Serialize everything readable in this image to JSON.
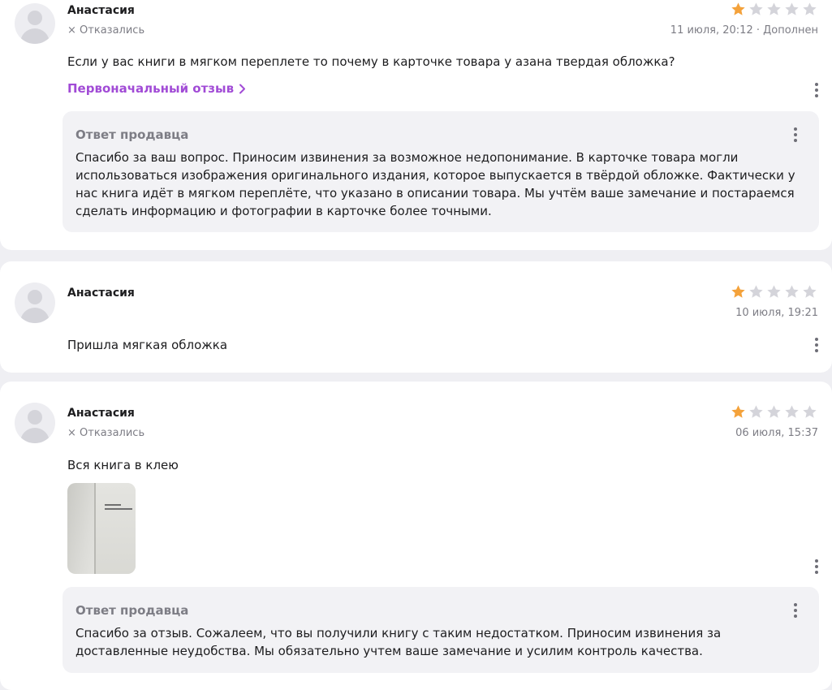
{
  "colors": {
    "star_filled": "#f4a23b",
    "star_empty": "#d4d4da",
    "link": "#a14bd6",
    "muted": "#7d7d85"
  },
  "reviews": [
    {
      "author": "Анастасия",
      "status": "Отказались",
      "rating": 1,
      "date": "11 июля, 20:12 · Дополнен",
      "text": "Если у вас книги в мягком переплете то почему в карточке товара у азана твердая обложка?",
      "original_link": "Первоначальный отзыв",
      "seller_reply": {
        "title": "Ответ продавца",
        "text": "Спасибо за ваш вопрос. Приносим извинения за возможное недопонимание. В карточке товара могли использоваться изображения оригинального издания, которое выпускается в твёрдой обложке. Фактически у нас книга идёт в мягком переплёте, что указано в описании товара. Мы учтём ваше замечание и постараемся сделать информацию и фотографии в карточке более точными."
      }
    },
    {
      "author": "Анастасия",
      "rating": 1,
      "date": "10 июля, 19:21",
      "text": "Пришла мягкая обложка"
    },
    {
      "author": "Анастасия",
      "status": "Отказались",
      "rating": 1,
      "date": "06 июля, 15:37",
      "text": "Вся книга в клею",
      "seller_reply": {
        "title": "Ответ продавца",
        "text": "Спасибо за отзыв. Сожалеем, что вы получили книгу с таким недостатком. Приносим извинения за доставленные неудобства. Мы обязательно учтем ваше замечание и усилим контроль качества."
      }
    }
  ]
}
